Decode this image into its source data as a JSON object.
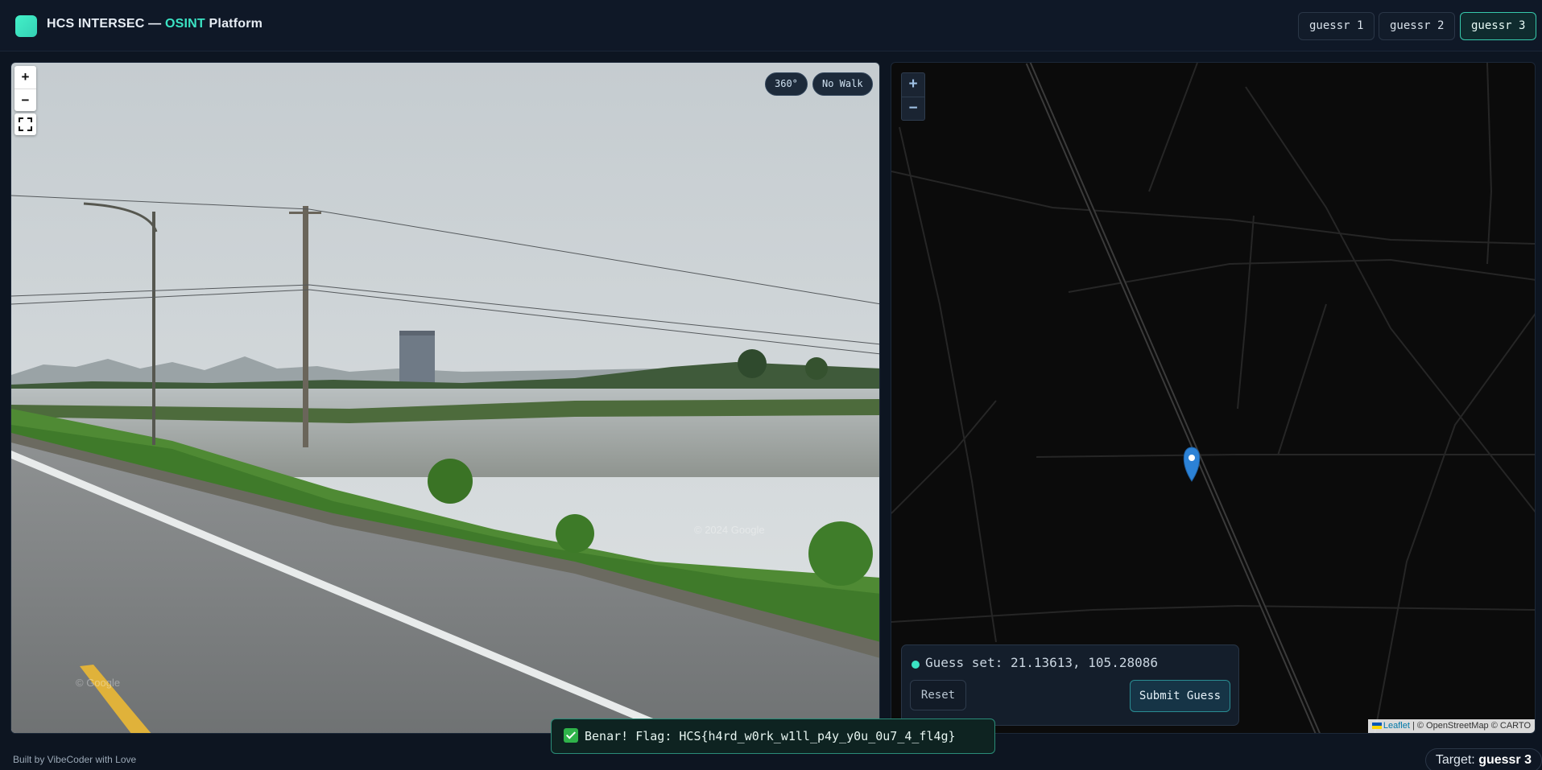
{
  "header": {
    "brand_prefix": "HCS INTERSEC — ",
    "brand_accent": "OSINT",
    "brand_suffix": " Platform",
    "tabs": [
      {
        "label": "guessr 1",
        "active": false
      },
      {
        "label": "guessr 2",
        "active": false
      },
      {
        "label": "guessr 3",
        "active": true
      }
    ]
  },
  "street_view": {
    "zoom_in": "+",
    "zoom_out": "−",
    "pill_360": "360°",
    "pill_walk": "No Walk",
    "watermark": "© 2024 Google",
    "watermark_small": "© Google",
    "icons": [
      "fullscreen-icon"
    ]
  },
  "map": {
    "zoom_in": "+",
    "zoom_out": "−",
    "attribution_leaflet": "Leaflet",
    "attribution_rest": " | © OpenStreetMap © CARTO",
    "guess": {
      "text": "Guess set: 21.13613, 105.28086",
      "reset_label": "Reset",
      "submit_label": "Submit Guess"
    }
  },
  "toast": {
    "message": "Benar! Flag: HCS{h4rd_w0rk_w1ll_p4y_y0u_0u7_4_fl4g}"
  },
  "footer": {
    "credit": "Built by VibeCoder with Love",
    "target_label": "Target: ",
    "target_value": "guessr 3"
  },
  "colors": {
    "accent": "#3be3c4",
    "background": "#0d1521",
    "success": "#2fb34a"
  }
}
